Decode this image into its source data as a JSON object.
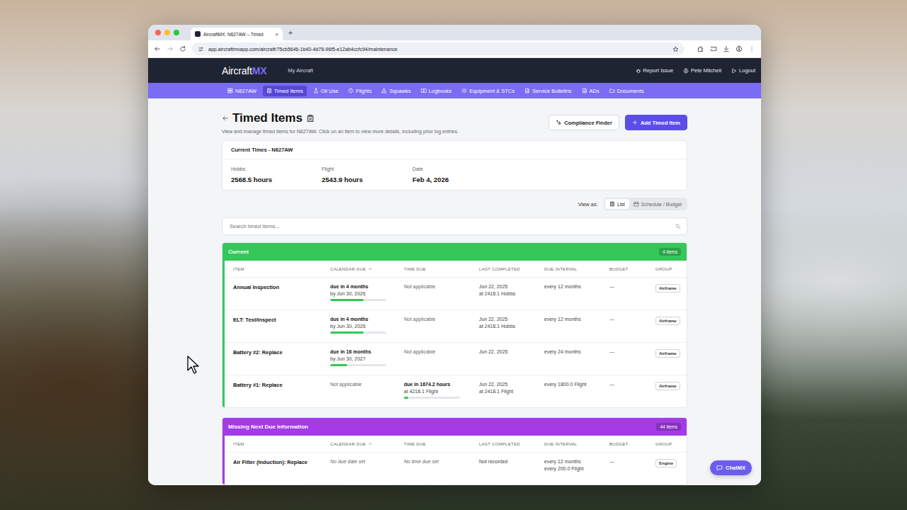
{
  "browser": {
    "tab_title": "AircraftMX: N627AW – Timed",
    "tab_close": "×",
    "new_tab": "+",
    "url": "app.aircraftmxapp.com/aircraft/75cb5646-1b40-4d76-96f5-e12ab4ccfc94/maintenance"
  },
  "header": {
    "logo": "Aircraft",
    "logo_accent": "MX",
    "link": "My Aircraft",
    "actions": [
      "Report Issue",
      "Pete Mitchell",
      "Logout"
    ]
  },
  "nav": [
    {
      "label": "N627AW",
      "selected": false
    },
    {
      "label": "Timed Items",
      "selected": true
    },
    {
      "label": "Oil Use",
      "selected": false
    },
    {
      "label": "Flights",
      "selected": false
    },
    {
      "label": "Squawks",
      "selected": false
    },
    {
      "label": "Logbooks",
      "selected": false
    },
    {
      "label": "Equipment & STCs",
      "selected": false
    },
    {
      "label": "Service Bulletins",
      "selected": false
    },
    {
      "label": "ADs",
      "selected": false
    },
    {
      "label": "Documents",
      "selected": false
    }
  ],
  "page": {
    "title": "Timed Items",
    "subtitle": "View and manage timed items for N627AW. Click on an item to view more details, including prior log entries.",
    "secondary_button": "Compliance Finder",
    "primary_button": "Add Timed Item"
  },
  "current_times": {
    "title": "Current Times - N627AW",
    "fields": [
      {
        "label": "Hobbs",
        "value": "2568.5 hours"
      },
      {
        "label": "Flight",
        "value": "2543.9 hours"
      },
      {
        "label": "Date",
        "value": "Feb 4, 2026"
      }
    ]
  },
  "view_as": {
    "label": "View as:",
    "options": [
      {
        "label": "List",
        "selected": true
      },
      {
        "label": "Schedule / Budget",
        "selected": false
      }
    ]
  },
  "search": {
    "placeholder": "Search timed items..."
  },
  "columns": [
    {
      "label": "ITEM",
      "sorted": false
    },
    {
      "label": "CALENDAR DUE",
      "sorted": true
    },
    {
      "label": "TIME DUE",
      "sorted": false
    },
    {
      "label": "LAST COMPLETED",
      "sorted": false
    },
    {
      "label": "DUE INTERVAL",
      "sorted": false
    },
    {
      "label": "BUDGET",
      "sorted": false
    },
    {
      "label": "GROUP",
      "sorted": false
    }
  ],
  "sections": [
    {
      "title": "Current",
      "count": "4 items",
      "color": "#34c759",
      "rows": [
        {
          "item": "Annual Inspection",
          "calendar_due": {
            "kind": "due",
            "text": "due in 4 months",
            "sub": "by Jun 30, 2026",
            "level": 0.6
          },
          "time_due": {
            "kind": "na",
            "text": "Not applicable"
          },
          "last_completed": [
            "Jun 22, 2025",
            "at 2418.1 Hobbs"
          ],
          "due_interval": [
            "every 12 months"
          ],
          "budget": "—",
          "group": "Airframe"
        },
        {
          "item": "ELT: Test/Inspect",
          "calendar_due": {
            "kind": "due",
            "text": "due in 4 months",
            "sub": "by Jun 30, 2026",
            "level": 0.6
          },
          "time_due": {
            "kind": "na",
            "text": "Not applicable"
          },
          "last_completed": [
            "Jun 22, 2025",
            "at 2418.1 Hobbs"
          ],
          "due_interval": [
            "every 12 months"
          ],
          "budget": "—",
          "group": "Airframe"
        },
        {
          "item": "Battery #2: Replace",
          "calendar_due": {
            "kind": "due",
            "text": "due in 16 months",
            "sub": "by Jun 30, 2027",
            "level": 0.3
          },
          "time_due": {
            "kind": "na",
            "text": "Not applicable"
          },
          "last_completed": [
            "Jun 22, 2025"
          ],
          "due_interval": [
            "every 24 months"
          ],
          "budget": "—",
          "group": "Airframe"
        },
        {
          "item": "Battery #1: Replace",
          "calendar_due": {
            "kind": "na",
            "text": "Not applicable"
          },
          "time_due": {
            "kind": "due",
            "text": "due in 1674.2 hours",
            "sub": "at 4218.1 Flight",
            "level": 0.07
          },
          "last_completed": [
            "Jun 22, 2025",
            "at 2418.1 Flight"
          ],
          "due_interval": [
            "every 1800.0 Flight"
          ],
          "budget": "—",
          "group": "Airframe"
        }
      ]
    },
    {
      "title": "Missing Next Due Information",
      "count": "44 items",
      "color": "#a43be6",
      "rows": [
        {
          "item": "Air Filter (Induction): Replace",
          "calendar_due": {
            "kind": "missing",
            "text": "No due date set"
          },
          "time_due": {
            "kind": "missing",
            "text": "No time due set"
          },
          "last_completed": [
            "Not recorded"
          ],
          "due_interval": [
            "every 12 months",
            "every 200.0 Flight"
          ],
          "budget": "—",
          "group": "Engine"
        }
      ]
    }
  ],
  "chat_button": "ChatMX"
}
